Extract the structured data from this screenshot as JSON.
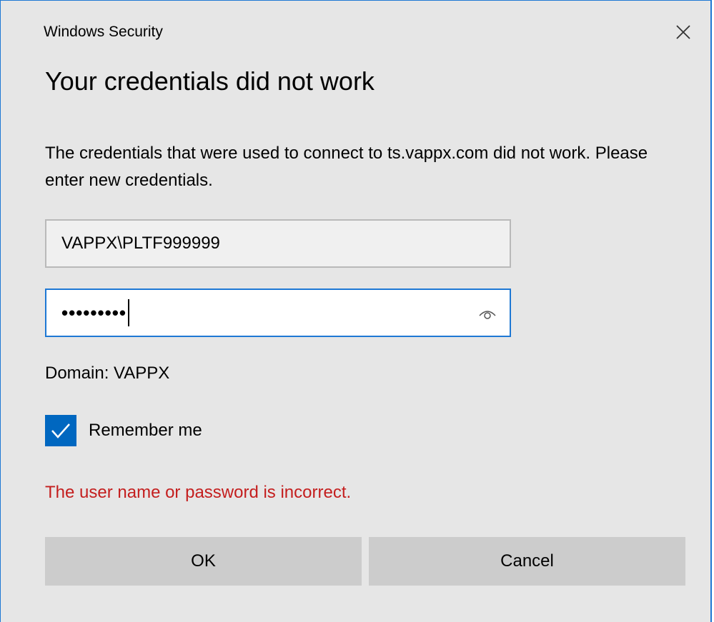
{
  "window": {
    "title": "Windows Security",
    "close_icon": "close-icon"
  },
  "dialog": {
    "heading": "Your credentials did not work",
    "message": "The credentials that were used to connect to ts.vappx.com did not work. Please enter new credentials.",
    "username_value": "VAPPX\\PLTF999999",
    "password_masked": "•••••••••",
    "reveal_icon": "eye-icon",
    "domain_text": "Domain: VAPPX",
    "remember_label": "Remember me",
    "remember_checked": true,
    "error_text": "The user name or password is incorrect.",
    "ok_label": "OK",
    "cancel_label": "Cancel"
  },
  "colors": {
    "accent": "#1e78d4",
    "checkbox": "#0067c0",
    "error": "#c41e1e",
    "background": "#e6e6e6",
    "button": "#cccccc"
  }
}
